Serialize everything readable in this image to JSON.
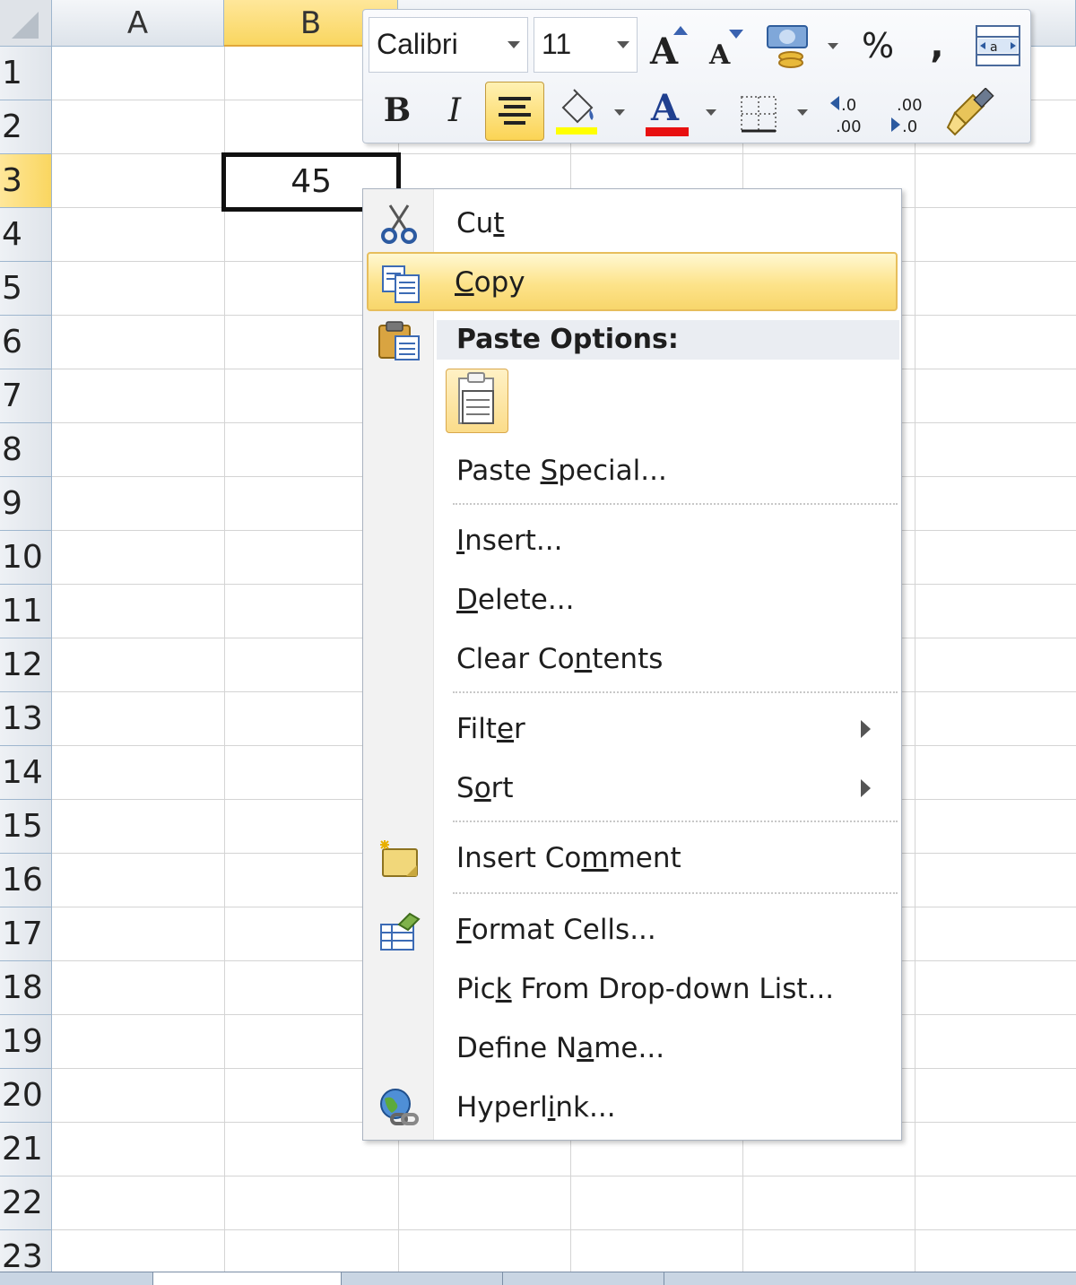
{
  "sheet": {
    "columns": [
      "A",
      "B"
    ],
    "rows": [
      "1",
      "2",
      "3",
      "4",
      "5",
      "6",
      "7",
      "8",
      "9",
      "10",
      "11",
      "12",
      "13",
      "14",
      "15",
      "16",
      "17",
      "18",
      "19",
      "20",
      "21",
      "22",
      "23"
    ],
    "active_cell": {
      "column": "B",
      "row": "3",
      "value": "45"
    }
  },
  "mini_toolbar": {
    "font_name": "Calibri",
    "font_size": "11",
    "buttons": [
      "grow-font",
      "shrink-font",
      "accounting-format",
      "percent-style",
      "comma-style",
      "merge-center",
      "bold",
      "italic",
      "align-center",
      "fill-color",
      "font-color",
      "borders",
      "increase-decimal",
      "decrease-decimal",
      "format-painter"
    ],
    "percent_label": "%",
    "comma_label": ",",
    "bold_label": "B",
    "italic_label": "I",
    "font_color_label": "A",
    "fill_color_bar": "#ffff00",
    "font_color_bar": "#e81010"
  },
  "context_menu": {
    "cut": {
      "pre": "Cu",
      "acc": "t",
      "post": ""
    },
    "copy": {
      "pre": "",
      "acc": "C",
      "post": "opy"
    },
    "paste_options_header": "Paste Options:",
    "paste_special": {
      "pre": "Paste ",
      "acc": "S",
      "post": "pecial..."
    },
    "insert": {
      "pre": "",
      "acc": "I",
      "post": "nsert..."
    },
    "delete": {
      "pre": "",
      "acc": "D",
      "post": "elete..."
    },
    "clear_contents": {
      "pre": "Clear Co",
      "acc": "n",
      "post": "tents"
    },
    "filter": {
      "pre": "Filt",
      "acc": "e",
      "post": "r"
    },
    "sort": {
      "pre": "S",
      "acc": "o",
      "post": "rt"
    },
    "insert_comment": {
      "pre": "Insert Co",
      "acc": "m",
      "post": "ment"
    },
    "format_cells": {
      "pre": "",
      "acc": "F",
      "post": "ormat Cells..."
    },
    "pick_from_list": {
      "pre": "Pic",
      "acc": "k",
      "post": " From Drop-down List..."
    },
    "define_name": {
      "pre": "Define N",
      "acc": "a",
      "post": "me..."
    },
    "hyperlink": {
      "pre": "Hyperl",
      "acc": "i",
      "post": "nk..."
    },
    "highlighted_item": "copy"
  }
}
